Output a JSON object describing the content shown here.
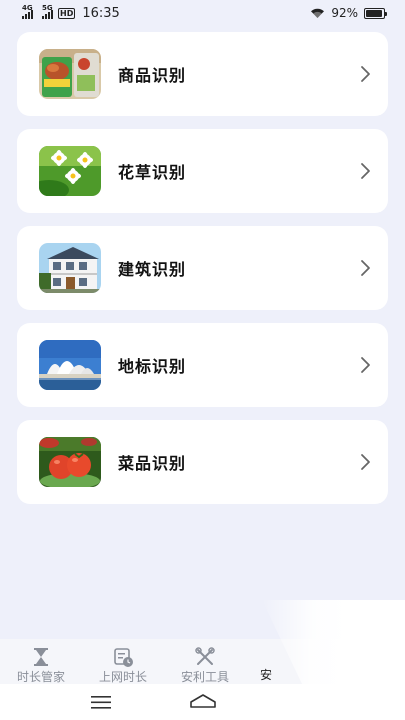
{
  "status_bar": {
    "network_1": "4G",
    "network_2": "5G",
    "hd": "HD",
    "time": "16:35",
    "battery": "92%",
    "battery_level": 0.92
  },
  "cards": [
    {
      "label": "商品识别",
      "icon": "product-photo"
    },
    {
      "label": "花草识别",
      "icon": "flower-photo"
    },
    {
      "label": "建筑识别",
      "icon": "building-photo"
    },
    {
      "label": "地标识别",
      "icon": "landmark-photo"
    },
    {
      "label": "菜品识别",
      "icon": "vegetable-photo"
    }
  ],
  "tabbar": {
    "tabs": [
      {
        "label": "时长管家",
        "icon": "hourglass-icon"
      },
      {
        "label": "上网时长",
        "icon": "clock-doc-icon"
      },
      {
        "label": "安利工具",
        "icon": "tools-icon"
      },
      {
        "label": "安"
      }
    ],
    "active_color": "#222222",
    "inactive_color": "#8a8f99"
  },
  "nav": {
    "buttons": [
      "menu-icon",
      "home-icon"
    ]
  }
}
